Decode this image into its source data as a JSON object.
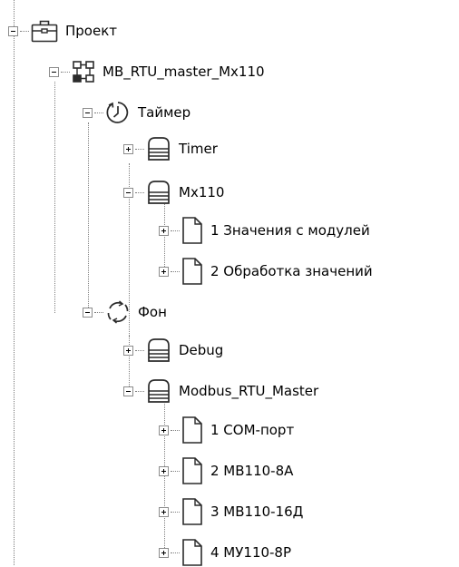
{
  "tree": {
    "project": {
      "label": "Проект",
      "icon": "briefcase-icon"
    },
    "program": {
      "label": "MB_RTU_master_Mx110",
      "icon": "network-blocks-icon"
    },
    "timer_task": {
      "label": "Таймер",
      "icon": "clock-icon"
    },
    "timer_macro": {
      "label": "Timer",
      "icon": "stack-icon"
    },
    "mx110_macro": {
      "label": "Mx110",
      "icon": "stack-icon"
    },
    "page_values": {
      "label": "1 Значения с модулей",
      "icon": "page-icon"
    },
    "page_processing": {
      "label": "2 Обработка значений",
      "icon": "page-icon"
    },
    "background_task": {
      "label": "Фон",
      "icon": "cycle-arrows-icon"
    },
    "debug_macro": {
      "label": "Debug",
      "icon": "stack-icon"
    },
    "modbus_macro": {
      "label": "Modbus_RTU_Master",
      "icon": "stack-icon"
    },
    "page_com": {
      "label": "1 COM-порт",
      "icon": "page-icon"
    },
    "page_mv8a": {
      "label": "2 МВ110-8А",
      "icon": "page-icon"
    },
    "page_mv16d": {
      "label": "3 МВ110-16Д",
      "icon": "page-icon"
    },
    "page_mu8r": {
      "label": "4 МУ110-8Р",
      "icon": "page-icon"
    }
  }
}
